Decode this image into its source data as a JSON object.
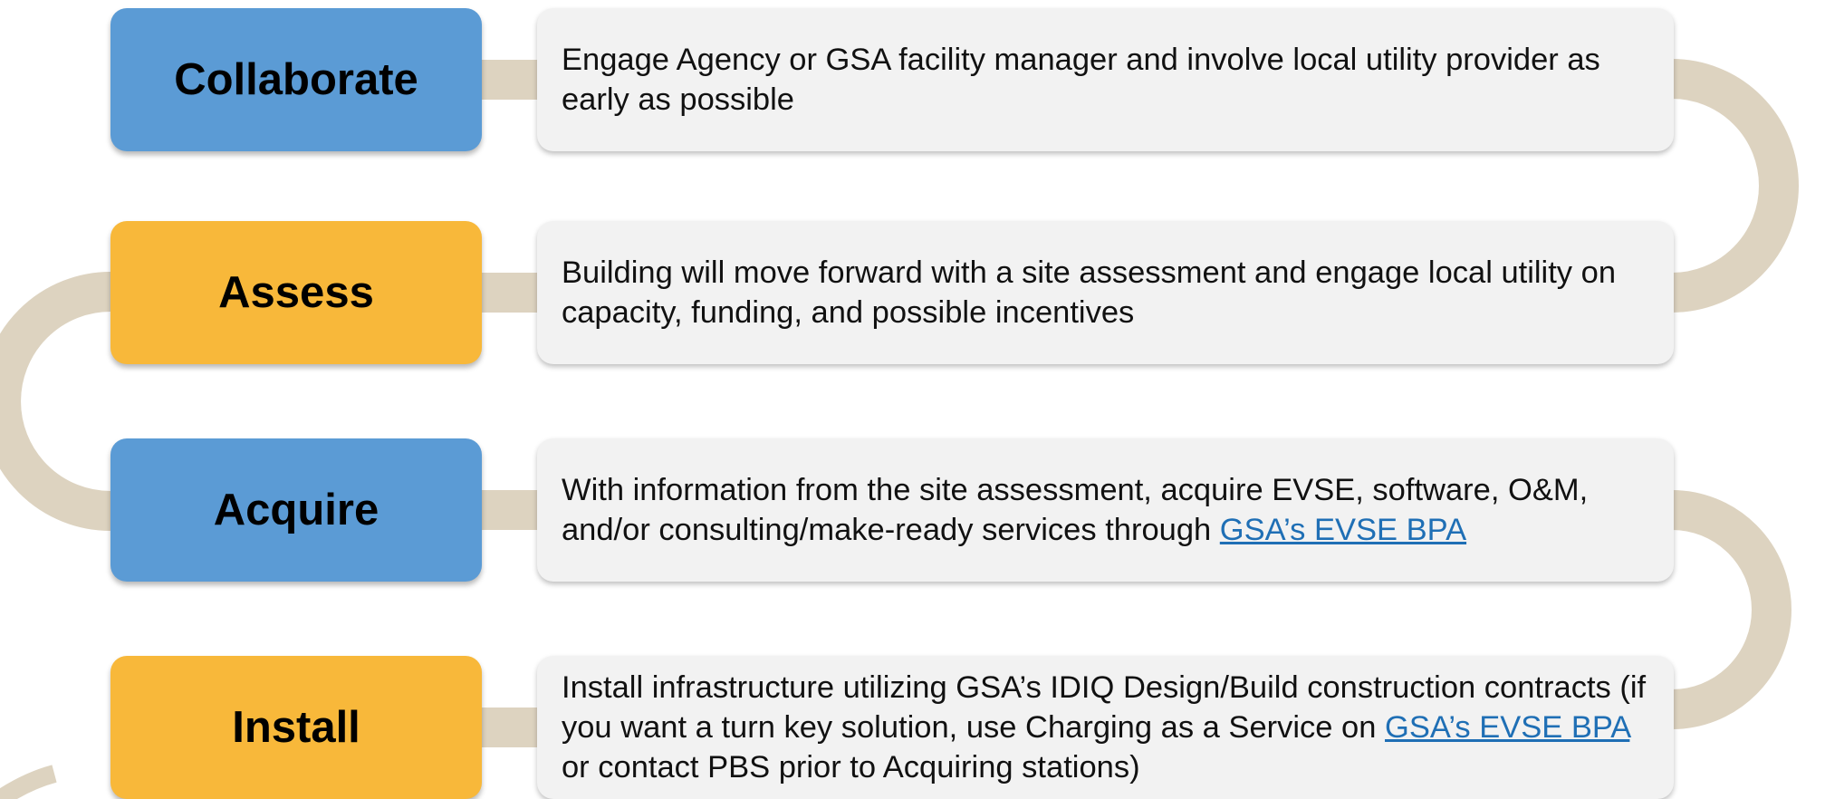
{
  "colors": {
    "blue": "#5b9bd5",
    "gold": "#f8b83a",
    "track": "#ddd3c0",
    "panel": "#f2f2f2",
    "link": "#1f6fb5"
  },
  "steps": [
    {
      "label": "Collaborate",
      "description": "Engage Agency or GSA facility manager and involve local utility provider as early as possible"
    },
    {
      "label": "Assess",
      "description": "Building will move forward with a site assessment and engage local utility on capacity, funding, and possible incentives"
    },
    {
      "label": "Acquire",
      "description_before": "With information from the site assessment, acquire EVSE, software, O&M, and/or consulting/make-ready services through ",
      "link": "GSA’s EVSE BPA"
    },
    {
      "label": "Install",
      "description_before": "Install infrastructure utilizing GSA’s IDIQ Design/Build construction contracts (if you want a turn key solution, use Charging as a Service on ",
      "link": "GSA’s EVSE BPA",
      "description_after": " or contact PBS prior to Acquiring stations)"
    }
  ]
}
